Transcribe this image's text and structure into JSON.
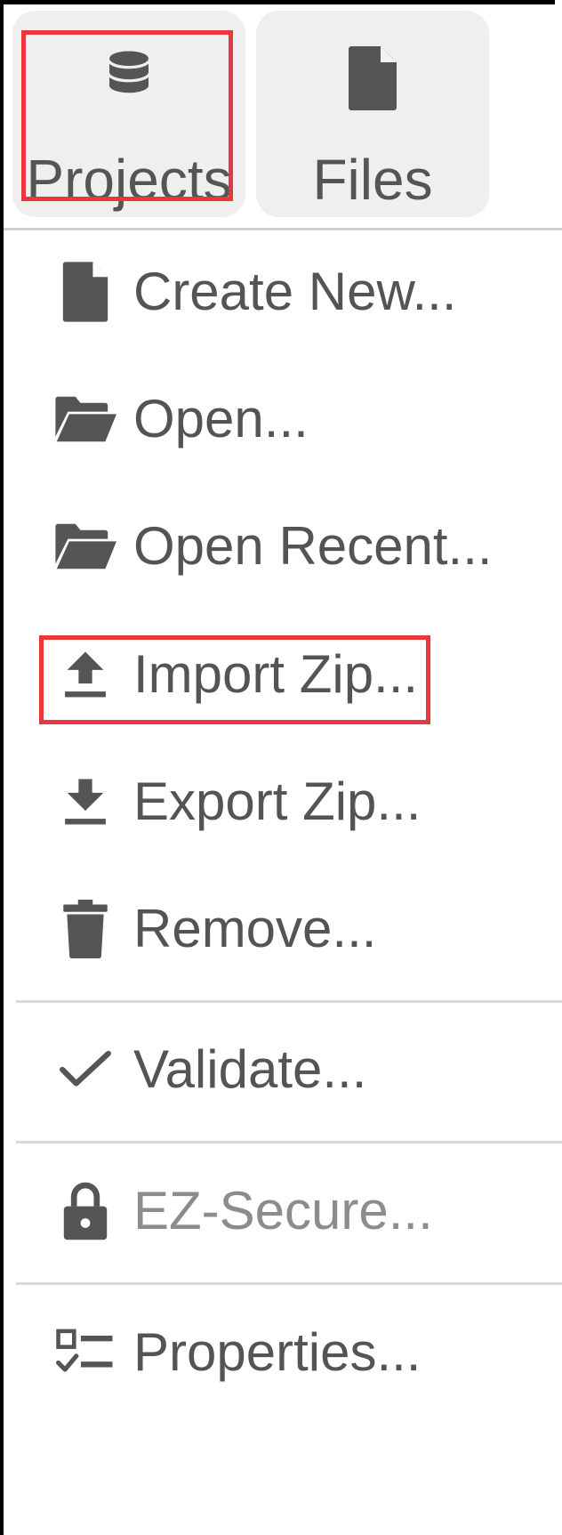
{
  "toolbar": {
    "tabs": [
      {
        "label": "Projects",
        "icon": "database-icon",
        "highlighted": true
      },
      {
        "label": "Files",
        "icon": "file-icon",
        "highlighted": false
      }
    ]
  },
  "menu": {
    "items": [
      {
        "label": "Create New...",
        "icon": "file-icon"
      },
      {
        "label": "Open...",
        "icon": "folder-open-icon"
      },
      {
        "label": "Open Recent...",
        "icon": "folder-open-icon"
      },
      {
        "label": "Import Zip...",
        "icon": "upload-icon",
        "highlighted": true
      },
      {
        "label": "Export Zip...",
        "icon": "download-icon"
      },
      {
        "label": "Remove...",
        "icon": "trash-icon"
      },
      {
        "label": "Validate...",
        "icon": "checkmark-icon"
      },
      {
        "label": "EZ-Secure...",
        "icon": "lock-icon",
        "disabled": true
      },
      {
        "label": "Properties...",
        "icon": "checklist-icon"
      }
    ]
  },
  "colors": {
    "highlight": "#e8383d",
    "icon": "#555555",
    "text": "#545454",
    "disabled_text": "#8c8c8c",
    "tab_bg": "#efefef"
  }
}
